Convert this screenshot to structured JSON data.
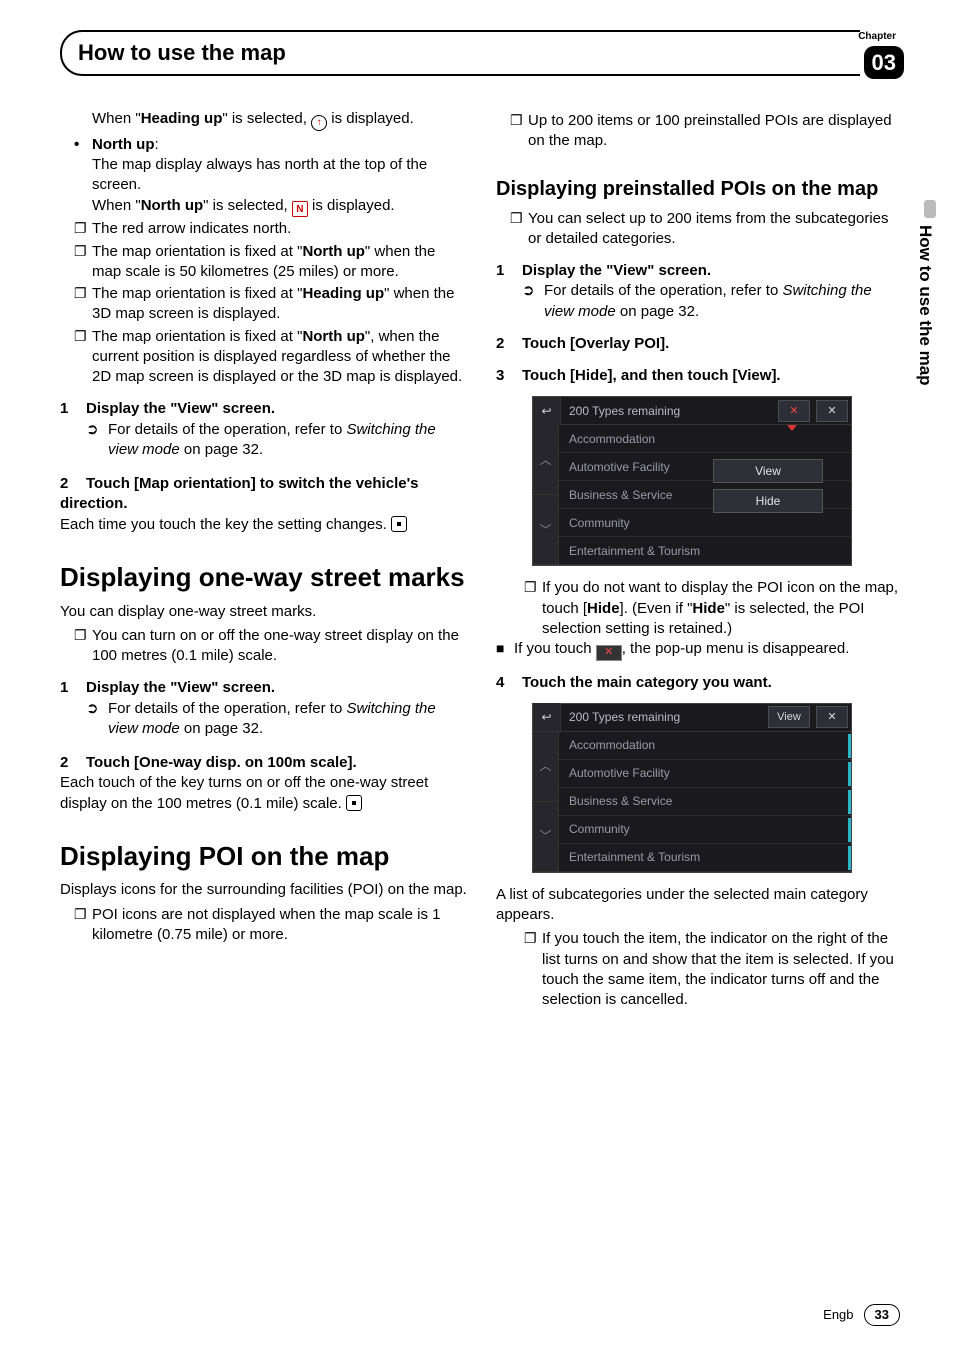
{
  "header": {
    "title": "How to use the map",
    "chapter_label": "Chapter",
    "chapter_num": "03",
    "side_tab": "How to use the map"
  },
  "left": {
    "p1_a": "When \"",
    "p1_b": "Heading up",
    "p1_c": "\" is selected, ",
    "p1_d": " is displayed.",
    "north_up_label": "North up",
    "north_up_colon": ":",
    "north_up_desc": "The map display always has north at the top of the screen.",
    "north_up_when_a": "When \"",
    "north_up_when_b": "North up",
    "north_up_when_c": "\" is selected, ",
    "north_up_when_d": " is displayed.",
    "bx1": "The red arrow indicates north.",
    "bx2_a": "The map orientation is fixed at \"",
    "bx2_b": "North up",
    "bx2_c": "\" when the map scale is 50 kilometres (25 miles) or more.",
    "bx3_a": "The map orientation is fixed at \"",
    "bx3_b": "Heading up",
    "bx3_c": "\" when the 3D map screen is displayed.",
    "bx4_a": "The map orientation is fixed at \"",
    "bx4_b": "North up",
    "bx4_c": "\", when the current position is displayed regardless of whether the 2D map screen is displayed or the 3D map is displayed.",
    "step1_num": "1",
    "step1_text": "Display the \"View\" screen.",
    "step1_ref_a": "For details of the operation, refer to ",
    "step1_ref_b": "Switching the view mode",
    "step1_ref_c": " on page 32.",
    "step2_num": "2",
    "step2_text": "Touch [Map orientation] to switch the vehicle's direction.",
    "step2_desc": "Each time you touch the key the setting changes.",
    "h_oneway": "Displaying one-way street marks",
    "oneway_intro": "You can display one-way street marks.",
    "oneway_bx": "You can turn on or off the one-way street display on the 100 metres (0.1 mile) scale.",
    "ow_step1_num": "1",
    "ow_step1_text": "Display the \"View\" screen.",
    "ow_step1_ref_a": "For details of the operation, refer to ",
    "ow_step1_ref_b": "Switching the view mode",
    "ow_step1_ref_c": " on page 32.",
    "ow_step2_num": "2",
    "ow_step2_text": "Touch [One-way disp. on 100m scale].",
    "ow_step2_desc": "Each touch of the key turns on or off the one-way street display on the 100 metres (0.1 mile) scale.",
    "h_poi": "Displaying POI on the map",
    "poi_intro": "Displays icons for the surrounding facilities (POI) on the map.",
    "poi_bx1": "POI icons are not displayed when the map scale is 1 kilometre (0.75 mile) or more."
  },
  "right": {
    "poi_bx2": "Up to 200 items or 100 preinstalled POIs are displayed on the map.",
    "h_preinstalled": "Displaying preinstalled POIs on the map",
    "pre_bx": "You can select up to 200 items from the subcategories or detailed categories.",
    "s1_num": "1",
    "s1_text": "Display the \"View\" screen.",
    "s1_ref_a": "For details of the operation, refer to ",
    "s1_ref_b": "Switching the view mode",
    "s1_ref_c": " on page 32.",
    "s2_num": "2",
    "s2_text": "Touch [Overlay POI].",
    "s3_num": "3",
    "s3_text": "Touch [Hide], and then touch [View].",
    "device1": {
      "title": "200 Types remaining",
      "btn_close1": "✕",
      "btn_close2": "✕",
      "popup_view": "View",
      "popup_hide": "Hide",
      "rows": [
        "Accommodation",
        "Automotive Facility",
        "Business & Service",
        "Community",
        "Entertainment & Tourism"
      ]
    },
    "s3_note_a": "If you do not want to display the POI icon on the map, touch [",
    "s3_note_b": "Hide",
    "s3_note_c": "]. (Even if \"",
    "s3_note_d": "Hide",
    "s3_note_e": "\" is selected, the POI selection setting is retained.)",
    "blk_a": "If you touch ",
    "blk_b": ", the pop-up menu is disappeared.",
    "s4_num": "4",
    "s4_text": "Touch the main category you want.",
    "device2": {
      "title": "200 Types remaining",
      "btn_view": "View",
      "btn_close": "✕",
      "rows": [
        "Accommodation",
        "Automotive Facility",
        "Business & Service",
        "Community",
        "Entertainment & Tourism"
      ]
    },
    "after_dev2": "A list of subcategories under the selected main category appears.",
    "after_bx": "If you touch the item, the indicator on the right of the list turns on and show that the item is selected. If you touch the same item, the indicator turns off and the selection is cancelled."
  },
  "footer": {
    "lang": "Engb",
    "page": "33"
  }
}
